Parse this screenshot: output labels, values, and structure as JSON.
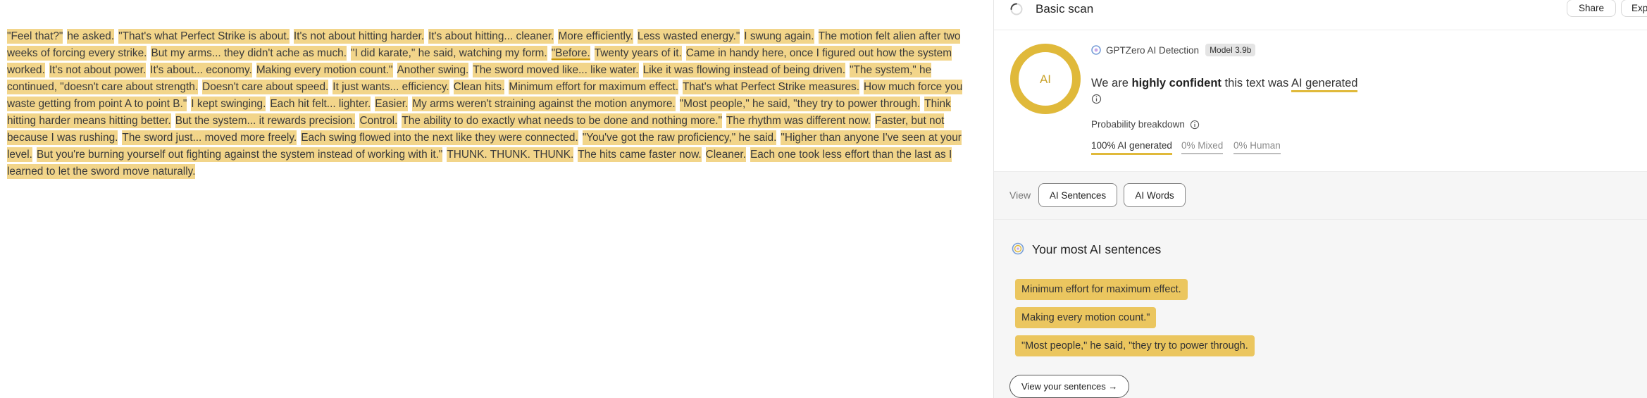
{
  "document": {
    "sentences": [
      "\"Feel that?\"",
      "he asked.",
      "\"That's what Perfect Strike is about.",
      "It's not about hitting harder.",
      "It's about hitting... cleaner.",
      "More efficiently.",
      "Less wasted energy.\"",
      "I swung again.",
      "The motion felt alien after two weeks of forcing every strike.",
      "But my arms... they didn't ache as much.",
      "\"I did karate,\" he said, watching my form.",
      "\"Before.",
      "Twenty years of it.",
      "Came in handy here, once I figured out how the system worked.",
      "It's not about power.",
      "It's about... economy.",
      "Making every motion count.\"",
      "Another swing.",
      "The sword moved like... like water.",
      "Like it was flowing instead of being driven.",
      "\"The system,\" he continued, \"doesn't care about strength.",
      "Doesn't care about speed.",
      "It just wants... efficiency.",
      "Clean hits.",
      "Minimum effort for maximum effect.",
      "That's what Perfect Strike measures.",
      "How much force you waste getting from point A to point B.\"",
      "I kept swinging.",
      "Each hit felt... lighter.",
      "Easier.",
      "My arms weren't straining against the motion anymore.",
      "\"Most people,\" he said, \"they try to power through.",
      "Think hitting harder means hitting better.",
      "But the system... it rewards precision.",
      "Control.",
      "The ability to do exactly what needs to be done and nothing more.\"",
      "The rhythm was different now.",
      "Faster, but not because I was rushing.",
      "The sword just... moved more freely.",
      "Each swing flowed into the next like they were connected.",
      "\"You've got the raw proficiency,\" he said.",
      "\"Higher than anyone I've seen at your level.",
      "But you're burning yourself out fighting against the system instead of working with it.\"",
      "THUNK. THUNK. THUNK.",
      "The hits came faster now.",
      "Cleaner.",
      "Each one took less effort than the last as I learned to let the sword move naturally."
    ]
  },
  "header": {
    "title": "Basic scan",
    "share_label": "Share",
    "export_label": "Expo"
  },
  "result": {
    "gauge_label": "AI",
    "gauge_fraction": 1.0,
    "detector_name": "GPTZero AI Detection",
    "model_badge": "Model 3.9b",
    "verdict_prefix": "We are",
    "verdict_confidence": "highly confident",
    "verdict_middle": "this text was",
    "verdict_result": "AI generated",
    "breakdown_label": "Probability breakdown",
    "breakdown": {
      "ai": "100% AI generated",
      "mixed": "0% Mixed",
      "human": "0% Human"
    }
  },
  "view": {
    "label": "View",
    "ai_sentences": "AI Sentences",
    "ai_words": "AI Words"
  },
  "most_ai": {
    "title": "Your most AI sentences",
    "sentences": [
      "Minimum effort for maximum effect.",
      "Making every motion count.\"",
      "\"Most people,\" he said, \"they try to power through."
    ],
    "view_button": "View your sentences →"
  },
  "colors": {
    "highlight": "#f2d58a",
    "accent": "#e0b93a",
    "chip": "#ebc65f"
  },
  "icons": [
    "scan-spinner-icon",
    "detector-logo-icon",
    "info-icon",
    "sparkle-icon"
  ]
}
